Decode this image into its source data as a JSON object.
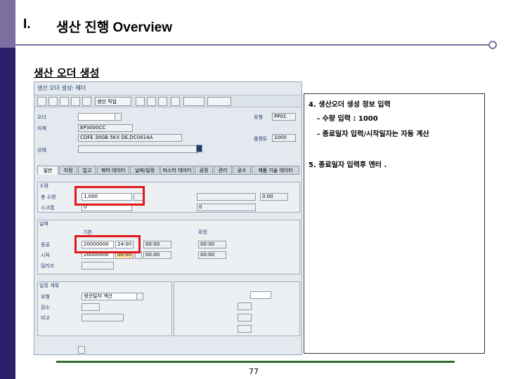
{
  "slide": {
    "section_number": "I.",
    "title": "생산 진행 Overview",
    "subtitle": "생산 오더 생성",
    "page_number": "77"
  },
  "sap": {
    "header_title": "생산 오더 생성: 헤더",
    "toolbar": {
      "materials_button": "",
      "operations_button": "생산 작업",
      "settings_button": "",
      "cost_button": "",
      "more_button": ""
    },
    "header_fields": {
      "order_label": "오더",
      "order_value": "",
      "order_type_label": "유형",
      "order_type_value": "PP01",
      "material_label": "자재",
      "material_value": "EP3000CC",
      "material_desc_value": "CDFE 30GB 5KX DE,DC0414A",
      "plant_label": "플랜트",
      "plant_value": "1000",
      "status_label": "상태",
      "status_value": ""
    },
    "tabs": [
      {
        "label": "일반"
      },
      {
        "label": "지정"
      },
      {
        "label": "입고"
      },
      {
        "label": "제어 데이터"
      },
      {
        "label": "날짜/일정"
      },
      {
        "label": "마스터 데이터"
      },
      {
        "label": "공정"
      },
      {
        "label": "관리"
      },
      {
        "label": "공수"
      },
      {
        "label": "제품 기술 데이터"
      }
    ],
    "quantity_group": {
      "title": "수량",
      "total_qty_label": "총 수량",
      "total_qty_value": "1,000",
      "scrap_label": "스크랩",
      "scrap_value": "0",
      "unit_value": "",
      "delivered_label": "",
      "delivered_value": "",
      "expected_label": "",
      "expected_value": "0",
      "unit_right_value": "0.00"
    },
    "dates_group": {
      "title": "날짜",
      "col_basic": "기본",
      "col_scheduled": "",
      "col_confirmed": "확정",
      "end_label": "종료",
      "end_date": "20000000",
      "end_time": "24:00",
      "end_scheduled": "00:00",
      "end_confirmed": "00:00",
      "start_label": "시작",
      "start_date": "20000000",
      "start_time": "00:00",
      "start_scheduled": "00:00",
      "start_confirmed": "00:00",
      "release_label": "릴리즈",
      "release_value": ""
    },
    "scheduling_group": {
      "title": "일정 계획",
      "type_label": "유형",
      "type_value": "생산일자 계산",
      "reduction_label": "감소",
      "note_label": "비고",
      "note_value": "",
      "floats_title": "",
      "sched_margin_label": "",
      "sched_margin_value": "",
      "float_before_label": "",
      "float_before_value": "",
      "float_after_label": "",
      "float_after_value": "",
      "release_period_label": "",
      "release_period_value": ""
    },
    "bottom_label": ""
  },
  "info": {
    "step4_title": "4. 생산오더 생성 정보 입력",
    "step4_line1": "- 수량 입력 : 1000",
    "step4_line2": "- 종료일자 입력/시작일자는 자동 계산",
    "step5_title": "5. 종료일자 입력후 엔터 ."
  },
  "colors": {
    "sidebar": "#2e1f6b",
    "accent": "#7a6fa0",
    "highlight": "#e0191f",
    "footer_rule": "#2f6b2f"
  }
}
